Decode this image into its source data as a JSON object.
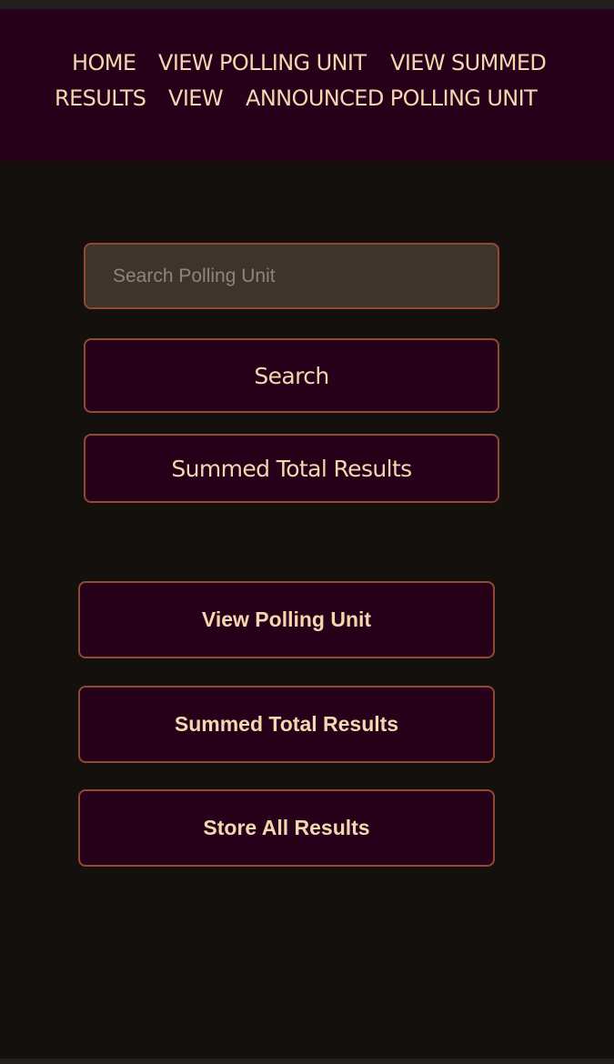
{
  "nav": {
    "home": "HOME",
    "view_polling_unit": "VIEW POLLING UNIT",
    "view_summed_1": "VIEW SUMMED",
    "view_summed_2": "RESULTS",
    "view_announced_1": "VIEW",
    "view_announced_2": "ANNOUNCED POLLING UNIT"
  },
  "search": {
    "placeholder": "Search Polling Unit",
    "value": "",
    "button_label": "Search"
  },
  "summed_total_button": "Summed Total Results",
  "actions": {
    "view_polling_unit": "View Polling Unit",
    "summed_total_results": "Summed Total Results",
    "store_all_results": "Store All Results"
  },
  "colors": {
    "page_background": "#13100e",
    "header_background": "#270019",
    "button_background": "#270019",
    "border": "#8e4a35",
    "text": "#f6d6b0",
    "input_background": "#3d342c",
    "placeholder_text": "#8f847a"
  }
}
